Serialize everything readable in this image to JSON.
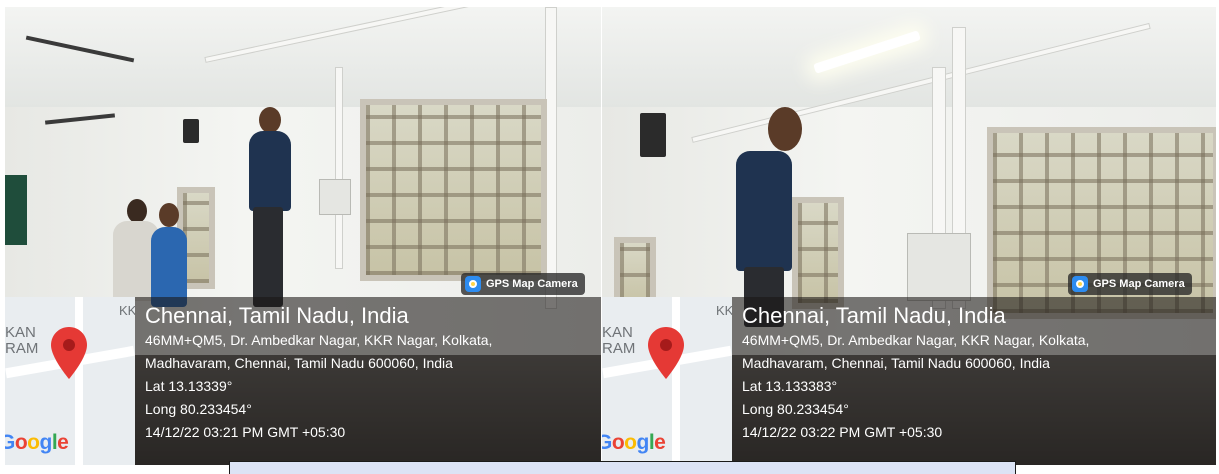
{
  "photos": [
    {
      "badge": "GPS Map Camera",
      "map_labels": [
        "KAN",
        "RAM"
      ],
      "map_corner": "KK",
      "google": "Google",
      "city": "Chennai, Tamil Nadu, India",
      "address_line1": "46MM+QM5, Dr. Ambedkar Nagar, KKR Nagar, Kolkata,",
      "address_line2": "Madhavaram, Chennai, Tamil Nadu 600060, India",
      "lat": "Lat 13.13339°",
      "long": "Long 80.233454°",
      "datetime": "14/12/22 03:21 PM GMT +05:30"
    },
    {
      "badge": "GPS Map Camera",
      "map_labels": [
        "KAN",
        "RAM"
      ],
      "map_corner": "KK",
      "google": "Google",
      "city": "Chennai, Tamil Nadu, India",
      "address_line1": "46MM+QM5, Dr. Ambedkar Nagar, KKR Nagar, Kolkata,",
      "address_line2": "Madhavaram, Chennai, Tamil Nadu 600060, India",
      "lat": "Lat 13.133383°",
      "long": "Long 80.233454°",
      "datetime": "14/12/22 03:22 PM GMT +05:30"
    }
  ],
  "colors": {
    "pin_red": "#e53935",
    "google_blue": "#4285F4",
    "google_red": "#EA4335",
    "google_yellow": "#FBBC05",
    "google_green": "#34A853",
    "caption_bg": "#dce3f5"
  }
}
